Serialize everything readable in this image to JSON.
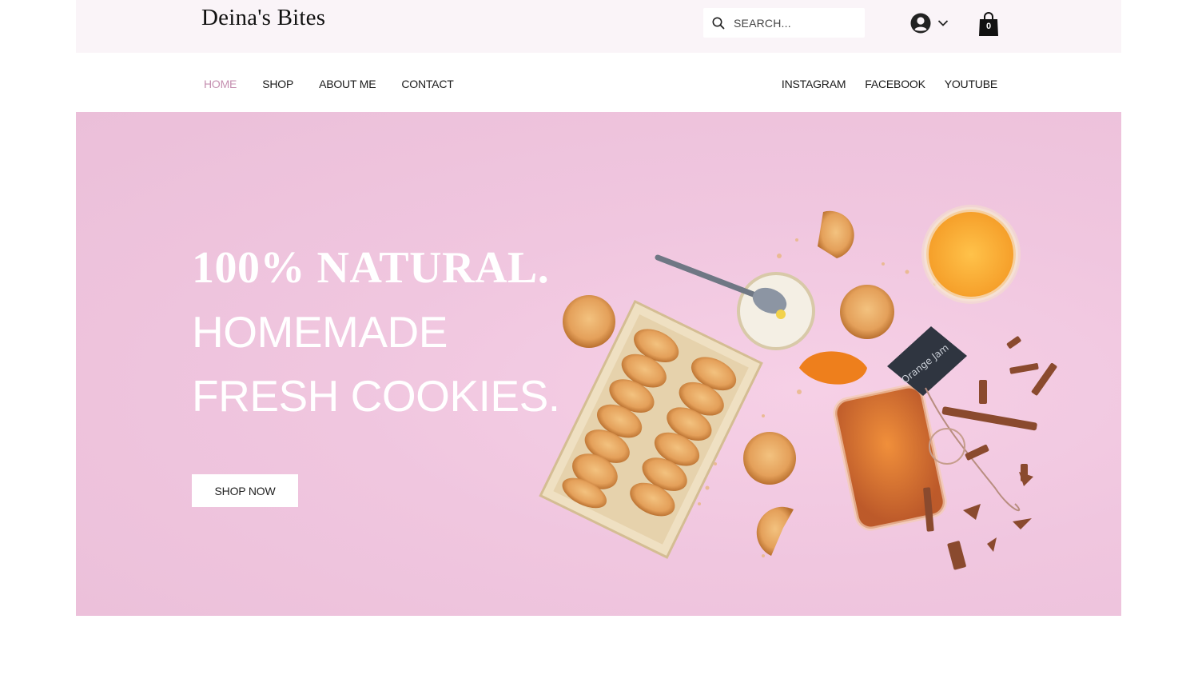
{
  "header": {
    "logo": "Deina's Bites",
    "search_placeholder": "SEARCH...",
    "cart_count": "0"
  },
  "nav": {
    "left": [
      {
        "label": "HOME",
        "active": true
      },
      {
        "label": "SHOP"
      },
      {
        "label": "ABOUT ME"
      },
      {
        "label": "CONTACT"
      }
    ],
    "right": [
      {
        "label": "INSTAGRAM"
      },
      {
        "label": "FACEBOOK"
      },
      {
        "label": "YOUTUBE"
      }
    ]
  },
  "hero": {
    "line1": "100% NATURAL.",
    "line2": "HOMEMADE",
    "line3": "FRESH COOKIES.",
    "cta": "SHOP NOW",
    "tag_text": "Orange Jam"
  },
  "colors": {
    "accent": "#c58fb0",
    "topbar_bg": "#faf4f8",
    "hero_bg": "#f0c6df"
  },
  "icons": [
    "search-icon",
    "account-icon",
    "chevron-down-icon",
    "shopping-bag-icon"
  ]
}
